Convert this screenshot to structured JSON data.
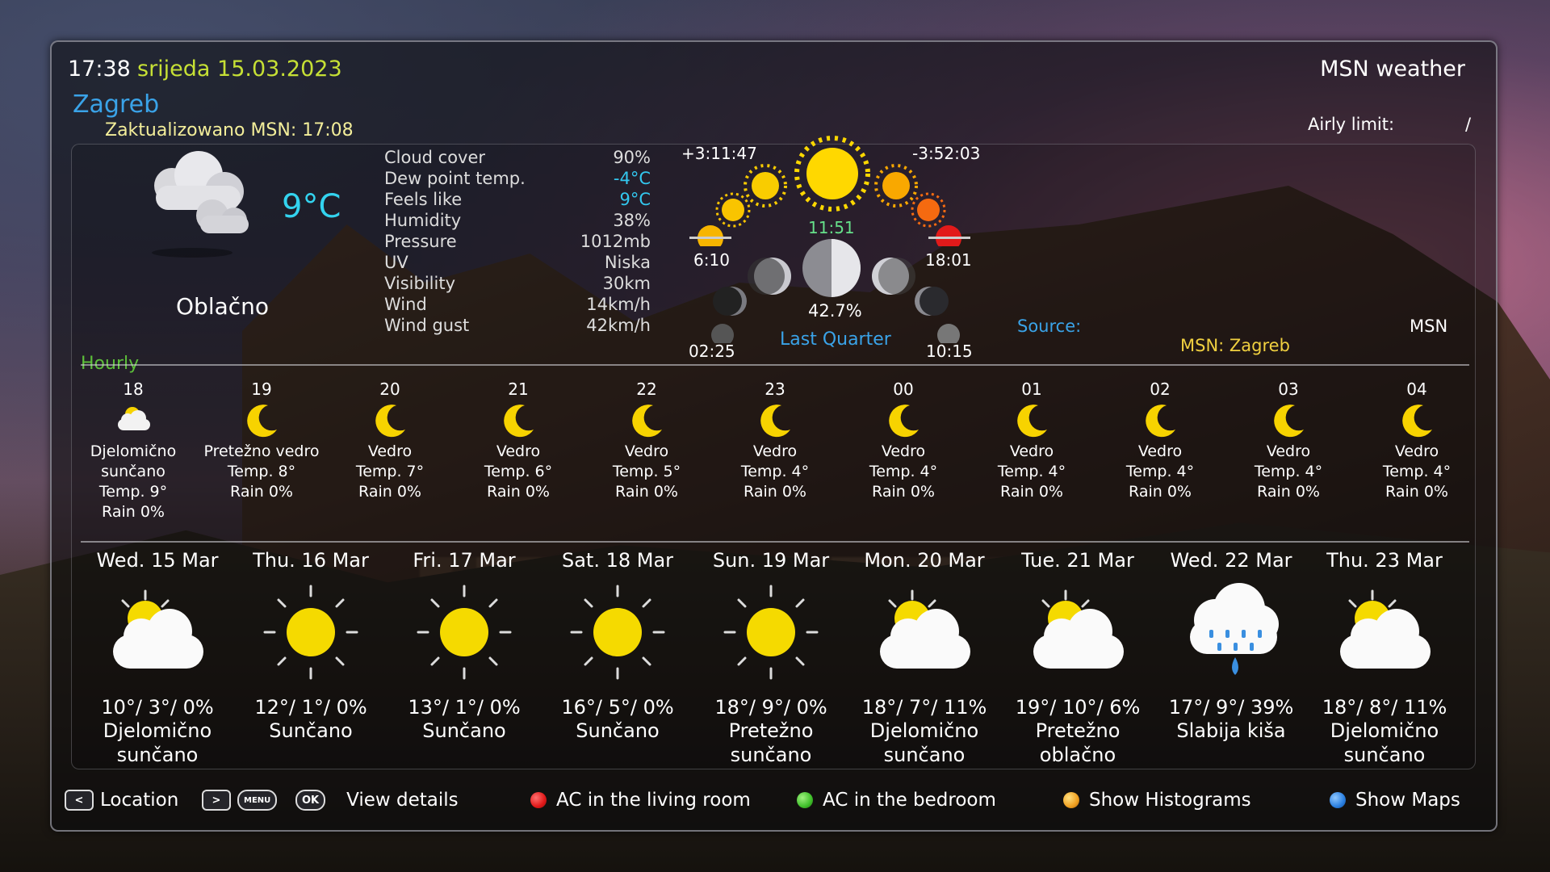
{
  "header": {
    "time": "17:38",
    "date": "srijeda 15.03.2023",
    "provider": "MSN weather",
    "city": "Zagreb",
    "updated": "Zaktualizowano MSN: 17:08",
    "airly_label": "Airly limit:",
    "airly_value": "/"
  },
  "current": {
    "icon": "cloudy-icon",
    "temperature": "9°C",
    "condition": "Oblačno",
    "details": [
      {
        "label": "Cloud cover",
        "value": "90%"
      },
      {
        "label": "Dew point temp.",
        "value": "-4°C",
        "accent": true
      },
      {
        "label": "Feels like",
        "value": "9°C",
        "accent": true
      },
      {
        "label": "Humidity",
        "value": "38%"
      },
      {
        "label": "Pressure",
        "value": "1012mb"
      },
      {
        "label": "UV",
        "value": "Niska"
      },
      {
        "label": "Visibility",
        "value": "30km"
      },
      {
        "label": "Wind",
        "value": "14km/h"
      },
      {
        "label": "Wind gust",
        "value": "42km/h"
      }
    ]
  },
  "sun": {
    "day_gain": "+3:11:47",
    "day_loss": "-3:52:03",
    "sunrise": "6:10",
    "noon": "11:51",
    "sunset": "18:01"
  },
  "moon": {
    "illumination": "42.7%",
    "phase": "Last Quarter",
    "moonrise": "02:25",
    "moonset": "10:15"
  },
  "source": {
    "label": "Source:",
    "value": "MSN",
    "location": "MSN: Zagreb"
  },
  "hourly": {
    "label": "Hourly",
    "items": [
      {
        "hour": "18",
        "icon": "partly-cloudy-night-icon",
        "cond": [
          "Djelomično",
          "sunčano"
        ],
        "temp": "Temp. 9°",
        "rain": "Rain 0%"
      },
      {
        "hour": "19",
        "icon": "moon-icon",
        "cond": [
          "Pretežno vedro"
        ],
        "temp": "Temp. 8°",
        "rain": "Rain 0%"
      },
      {
        "hour": "20",
        "icon": "moon-icon",
        "cond": [
          "Vedro"
        ],
        "temp": "Temp. 7°",
        "rain": "Rain 0%"
      },
      {
        "hour": "21",
        "icon": "moon-icon",
        "cond": [
          "Vedro"
        ],
        "temp": "Temp. 6°",
        "rain": "Rain 0%"
      },
      {
        "hour": "22",
        "icon": "moon-icon",
        "cond": [
          "Vedro"
        ],
        "temp": "Temp. 5°",
        "rain": "Rain 0%"
      },
      {
        "hour": "23",
        "icon": "moon-icon",
        "cond": [
          "Vedro"
        ],
        "temp": "Temp. 4°",
        "rain": "Rain 0%"
      },
      {
        "hour": "00",
        "icon": "moon-icon",
        "cond": [
          "Vedro"
        ],
        "temp": "Temp. 4°",
        "rain": "Rain 0%"
      },
      {
        "hour": "01",
        "icon": "moon-icon",
        "cond": [
          "Vedro"
        ],
        "temp": "Temp. 4°",
        "rain": "Rain 0%"
      },
      {
        "hour": "02",
        "icon": "moon-icon",
        "cond": [
          "Vedro"
        ],
        "temp": "Temp. 4°",
        "rain": "Rain 0%"
      },
      {
        "hour": "03",
        "icon": "moon-icon",
        "cond": [
          "Vedro"
        ],
        "temp": "Temp. 4°",
        "rain": "Rain 0%"
      },
      {
        "hour": "04",
        "icon": "moon-icon",
        "cond": [
          "Vedro"
        ],
        "temp": "Temp. 4°",
        "rain": "Rain 0%"
      }
    ]
  },
  "daily": [
    {
      "day": "Wed. 15 Mar",
      "icon": "partly-sunny-icon",
      "summary": "10°/ 3°/ 0%",
      "cond": [
        "Djelomično",
        "sunčano"
      ]
    },
    {
      "day": "Thu. 16 Mar",
      "icon": "sun-icon",
      "summary": "12°/ 1°/ 0%",
      "cond": [
        "Sunčano"
      ]
    },
    {
      "day": "Fri. 17 Mar",
      "icon": "sun-icon",
      "summary": "13°/ 1°/ 0%",
      "cond": [
        "Sunčano"
      ]
    },
    {
      "day": "Sat. 18 Mar",
      "icon": "sun-icon",
      "summary": "16°/ 5°/ 0%",
      "cond": [
        "Sunčano"
      ]
    },
    {
      "day": "Sun. 19 Mar",
      "icon": "sun-icon",
      "summary": "18°/ 9°/ 0%",
      "cond": [
        "Pretežno",
        "sunčano"
      ]
    },
    {
      "day": "Mon. 20 Mar",
      "icon": "partly-sunny-icon",
      "summary": "18°/ 7°/ 11%",
      "cond": [
        "Djelomično",
        "sunčano"
      ]
    },
    {
      "day": "Tue. 21 Mar",
      "icon": "partly-sunny-icon",
      "summary": "19°/ 10°/ 6%",
      "cond": [
        "Pretežno",
        "oblačno"
      ]
    },
    {
      "day": "Wed. 22 Mar",
      "icon": "rain-icon",
      "summary": "17°/ 9°/ 39%",
      "cond": [
        "Slabija kiša"
      ]
    },
    {
      "day": "Thu. 23 Mar",
      "icon": "partly-sunny-icon",
      "summary": "18°/ 8°/ 11%",
      "cond": [
        "Djelomično",
        "sunčano"
      ]
    }
  ],
  "footer": {
    "location_key": "<",
    "location_label": "Location",
    "next_key": ">",
    "menu_key": "MENU",
    "ok_key": "OK",
    "details_label": "View details",
    "red_label": "AC in the living room",
    "green_label": "AC in the bedroom",
    "yellow_label": "Show Histograms",
    "blue_label": "Show Maps"
  },
  "colors": {
    "date": "#c6e035",
    "city": "#3aa3e8",
    "temp": "#33d3ef",
    "red": "#e01818",
    "green": "#3fc02a",
    "yellow": "#f0a020",
    "blue": "#2a7fe0"
  }
}
